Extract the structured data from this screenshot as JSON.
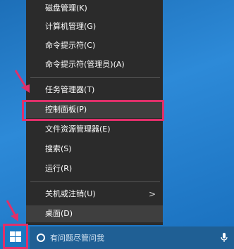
{
  "context_menu": {
    "items": [
      {
        "label": "磁盘管理(K)"
      },
      {
        "label": "计算机管理(G)"
      },
      {
        "label": "命令提示符(C)"
      },
      {
        "label": "命令提示符(管理员)(A)"
      },
      {
        "label": "任务管理器(T)"
      },
      {
        "label": "控制面板(P)"
      },
      {
        "label": "文件资源管理器(E)"
      },
      {
        "label": "搜索(S)"
      },
      {
        "label": "运行(R)"
      },
      {
        "label": "关机或注销(U)"
      },
      {
        "label": "桌面(D)"
      }
    ],
    "highlighted_item": "控制面板(P)",
    "shutdown_submenu_arrow": ">"
  },
  "taskbar": {
    "search_placeholder": "有问题尽管问我",
    "start_icon": "windows-logo-icon",
    "mic_icon": "microphone-icon"
  },
  "colors": {
    "annotation": "#e0306a",
    "menu_bg": "#2b2b2b",
    "taskbar": "#1a78c2"
  }
}
